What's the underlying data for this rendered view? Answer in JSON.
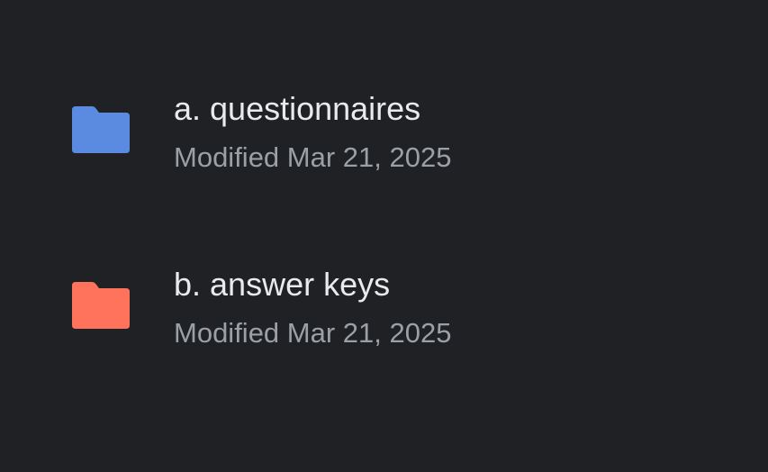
{
  "files": [
    {
      "name": "a. questionnaires",
      "modified": "Modified Mar 21, 2025",
      "icon": "folder-icon",
      "color": "#5b8be0"
    },
    {
      "name": "b. answer keys",
      "modified": "Modified Mar 21, 2025",
      "icon": "folder-icon",
      "color": "#ff735c"
    }
  ]
}
